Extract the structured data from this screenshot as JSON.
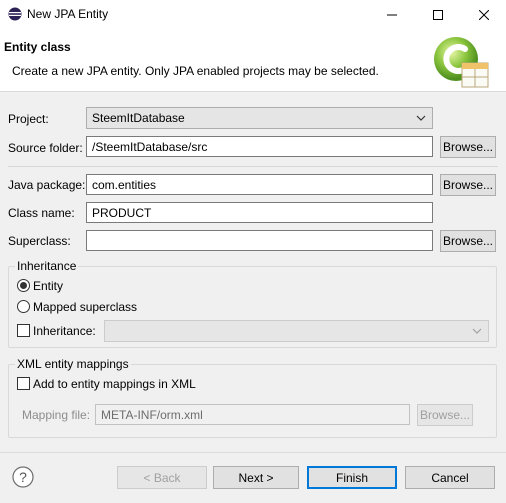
{
  "window": {
    "title": "New JPA Entity",
    "icons": {
      "app": "eclipse-icon",
      "minimize": "minimize-icon",
      "maximize": "maximize-icon",
      "close": "close-icon"
    }
  },
  "banner": {
    "title": "Entity class",
    "description": "Create a new JPA entity. Only JPA enabled projects may be selected.",
    "icon": "jpa-entity-wizard-icon"
  },
  "form": {
    "project": {
      "label": "Project:",
      "value": "SteemItDatabase"
    },
    "source_folder": {
      "label": "Source folder:",
      "value": "/SteemItDatabase/src",
      "button": "Browse..."
    },
    "java_package": {
      "label": "Java package:",
      "value": "com.entities",
      "button": "Browse..."
    },
    "class_name": {
      "label": "Class name:",
      "value": "PRODUCT"
    },
    "superclass": {
      "label": "Superclass:",
      "value": "",
      "button": "Browse..."
    }
  },
  "inheritance": {
    "legend": "Inheritance",
    "entity_label": "Entity",
    "entity_selected": true,
    "mapped_superclass_label": "Mapped superclass",
    "mapped_superclass_selected": false,
    "inheritance_label": "Inheritance:",
    "inheritance_checked": false,
    "inheritance_value": ""
  },
  "xml": {
    "legend": "XML entity mappings",
    "add_label": "Add to entity mappings in XML",
    "add_checked": false,
    "mapping_file_label": "Mapping file:",
    "mapping_file_value": "META-INF/orm.xml",
    "browse_label": "Browse..."
  },
  "footer": {
    "help_icon": "help-icon",
    "back": "< Back",
    "next": "Next >",
    "finish": "Finish",
    "cancel": "Cancel"
  }
}
